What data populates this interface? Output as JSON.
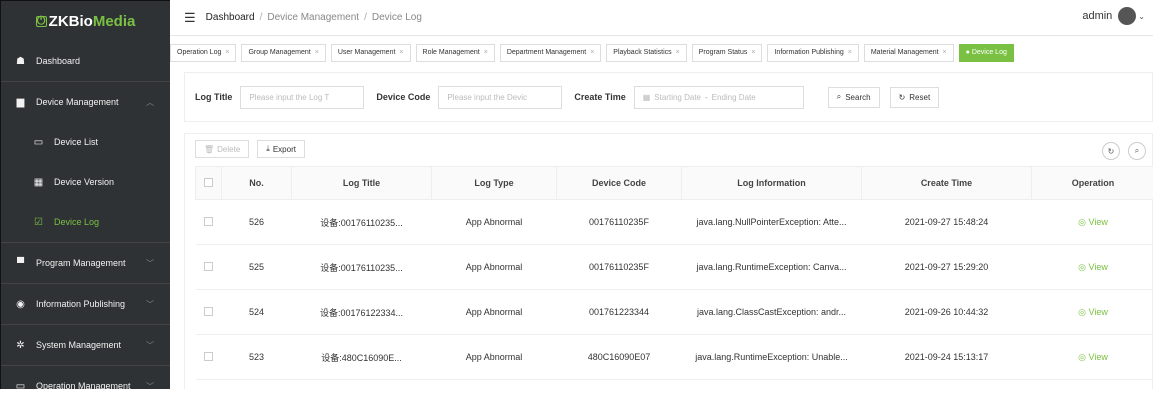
{
  "app": {
    "logo_prefix": "ZKBio",
    "logo_suffix": "Media"
  },
  "sidebar": {
    "items": [
      {
        "label": "Dashboard",
        "icon": "dashboard-icon",
        "glyph": "☗"
      },
      {
        "label": "Device Management",
        "icon": "device-icon",
        "glyph": "▆",
        "chev": "︿"
      },
      {
        "label": "Device List",
        "icon": "list-icon",
        "glyph": "▭"
      },
      {
        "label": "Device Version",
        "icon": "grid-icon",
        "glyph": "▦"
      },
      {
        "label": "Device Log",
        "icon": "log-icon",
        "glyph": "☑"
      },
      {
        "label": "Program Management",
        "icon": "folder-icon",
        "glyph": "▀",
        "chev": "﹀"
      },
      {
        "label": "Information Publishing",
        "icon": "publish-icon",
        "glyph": "◉",
        "chev": "﹀"
      },
      {
        "label": "System Management",
        "icon": "gear-icon",
        "glyph": "✲",
        "chev": "﹀"
      },
      {
        "label": "Operation Management",
        "icon": "monitor-icon",
        "glyph": "▭",
        "chev": "﹀"
      }
    ]
  },
  "header": {
    "breadcrumb": [
      "Dashboard",
      "Device Management",
      "Device Log"
    ],
    "separator": "/",
    "user": "admin"
  },
  "tabs": [
    {
      "label": "Operation Log"
    },
    {
      "label": "Group Management"
    },
    {
      "label": "User Management"
    },
    {
      "label": "Role Management"
    },
    {
      "label": "Department Management"
    },
    {
      "label": "Playback Statistics"
    },
    {
      "label": "Program Status"
    },
    {
      "label": "Information Publishing"
    },
    {
      "label": "Material Management"
    },
    {
      "label": "Device Log"
    }
  ],
  "search": {
    "log_title_label": "Log Title",
    "log_title_placeholder": "Please input the Log T",
    "device_code_label": "Device Code",
    "device_code_placeholder": "Please input the Devic",
    "create_time_label": "Create Time",
    "start_placeholder": "Starting Date",
    "end_placeholder": "Ending Date",
    "range_sep": "-",
    "search_btn": "Search",
    "reset_btn": "Reset"
  },
  "toolbar": {
    "delete": "Delete",
    "export": "Export"
  },
  "table": {
    "columns": [
      "No.",
      "Log Title",
      "Log Type",
      "Device Code",
      "Log Information",
      "Create Time",
      "Operation"
    ],
    "rows": [
      {
        "no": "526",
        "title": "设备:00176110235...",
        "type": "App Abnormal",
        "code": "00176110235F",
        "info": "java.lang.NullPointerException: Atte...",
        "time": "2021-09-27 15:48:24",
        "op": "View"
      },
      {
        "no": "525",
        "title": "设备:00176110235...",
        "type": "App Abnormal",
        "code": "00176110235F",
        "info": "java.lang.RuntimeException: Canva...",
        "time": "2021-09-27 15:29:20",
        "op": "View"
      },
      {
        "no": "524",
        "title": "设备:00176122334...",
        "type": "App Abnormal",
        "code": "001761223344",
        "info": "java.lang.ClassCastException: andr...",
        "time": "2021-09-26 10:44:32",
        "op": "View"
      },
      {
        "no": "523",
        "title": "设备:480C16090E...",
        "type": "App Abnormal",
        "code": "480C16090E07",
        "info": "java.lang.RuntimeException: Unable...",
        "time": "2021-09-24 15:13:17",
        "op": "View"
      }
    ]
  },
  "colors": {
    "accent": "#7ac143",
    "sidebar_bg": "#2f3234"
  }
}
